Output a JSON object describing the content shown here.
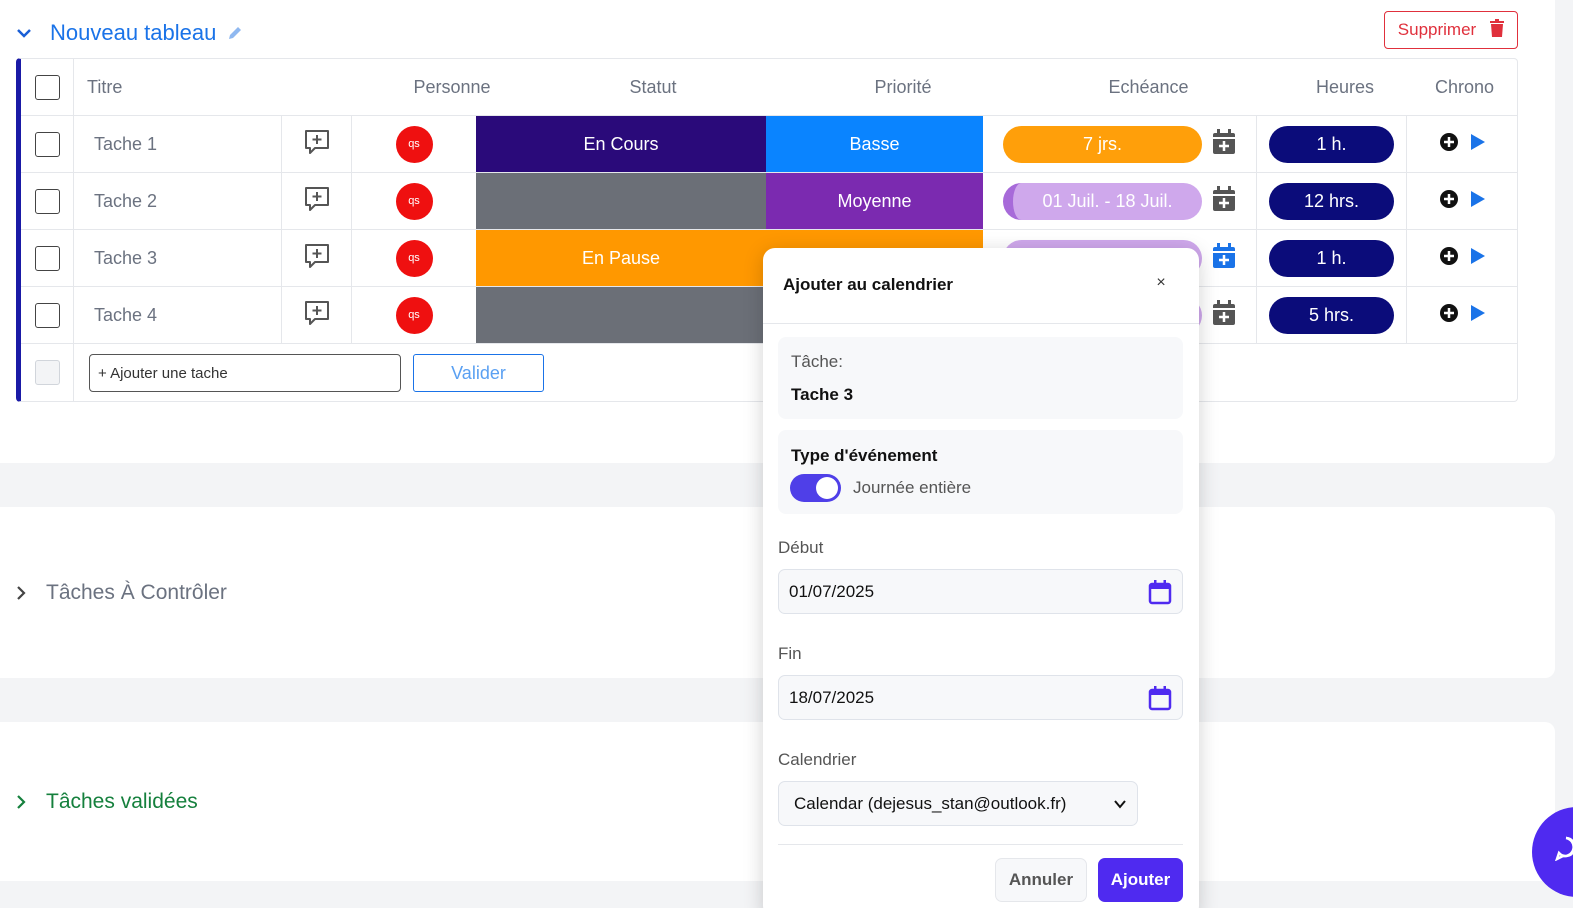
{
  "board": {
    "title": "Nouveau tableau",
    "delete_label": "Supprimer",
    "columns": {
      "title": "Titre",
      "person": "Personne",
      "status": "Statut",
      "priority": "Priorité",
      "due": "Echéance",
      "hours": "Heures",
      "chrono": "Chrono"
    },
    "tasks": [
      {
        "name": "Tache 1",
        "avatar": "qs",
        "status": "En Cours",
        "status_color": "#2a0a7a",
        "priority": "Basse",
        "priority_color": "#0a84ff",
        "due": "7 jrs.",
        "due_color": "#ff9f0a",
        "hours": "1 h."
      },
      {
        "name": "Tache 2",
        "avatar": "qs",
        "status": "",
        "status_color": "#6b6f77",
        "priority": "Moyenne",
        "priority_color": "#7b2ab0",
        "due": "01 Juil. - 18 Juil.",
        "due_color": "#cfa8ec",
        "hours": "12 hrs."
      },
      {
        "name": "Tache 3",
        "avatar": "qs",
        "status": "En Pause",
        "status_color": "#ff9800",
        "priority": "",
        "priority_color": "#ff9800",
        "due": "",
        "due_color": "#cfa8ec",
        "hours": "1 h."
      },
      {
        "name": "Tache 4",
        "avatar": "qs",
        "status": "",
        "status_color": "#6b6f77",
        "priority": "",
        "priority_color": "#6b6f77",
        "due": "",
        "due_color": "#cfa8ec",
        "hours": "5 hrs."
      }
    ],
    "add_task_placeholder": "+ Ajouter une tache",
    "validate_label": "Valider"
  },
  "groups": [
    {
      "title": "Tâches À Contrôler",
      "color": "#6b7280"
    },
    {
      "title": "Tâches validées",
      "color": "#15803d"
    }
  ],
  "modal": {
    "title": "Ajouter au calendrier",
    "close_label": "×",
    "task_label": "Tâche:",
    "task_value": "Tache 3",
    "event_type_label": "Type d'événement",
    "full_day_label": "Journée entière",
    "full_day_on": true,
    "start_label": "Début",
    "start_value": "01/07/2025",
    "end_label": "Fin",
    "end_value": "18/07/2025",
    "calendar_label": "Calendrier",
    "calendar_value": "Calendar (dejesus_stan@outlook.fr)",
    "cancel_label": "Annuler",
    "add_label": "Ajouter"
  },
  "colors": {
    "accent": "#4f2af0",
    "link": "#1a73e8",
    "danger": "#e0303c",
    "hours_pill": "#0b0c7a"
  }
}
